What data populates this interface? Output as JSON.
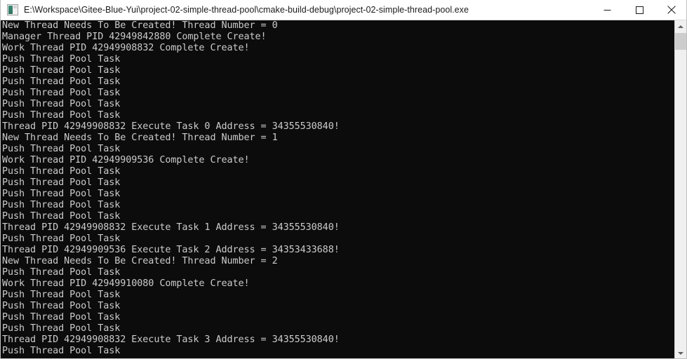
{
  "window": {
    "title": "E:\\Workspace\\Gitee-Blue-Yui\\project-02-simple-thread-pool\\cmake-build-debug\\project-02-simple-thread-pool.exe",
    "icon": "console-app-icon",
    "background_color": "#0c0c0c",
    "text_color": "#cccccc",
    "titlebar_color": "#ffffff"
  },
  "caption": {
    "minimize_label": "Minimize",
    "maximize_label": "Maximize",
    "close_label": "Close"
  },
  "scrollbar": {
    "up_arrow_label": "Scroll up",
    "down_arrow_label": "Scroll down",
    "thumb_label": "Scroll thumb"
  },
  "console": {
    "lines": [
      "New Thread Needs To Be Created! Thread Number = 0",
      "Manager Thread PID 42949842880 Complete Create!",
      "Work Thread PID 42949908832 Complete Create!",
      "Push Thread Pool Task",
      "Push Thread Pool Task",
      "Push Thread Pool Task",
      "Push Thread Pool Task",
      "Push Thread Pool Task",
      "Push Thread Pool Task",
      "Thread PID 42949908832 Execute Task 0 Address = 34355530840!",
      "New Thread Needs To Be Created! Thread Number = 1",
      "Push Thread Pool Task",
      "Work Thread PID 42949909536 Complete Create!",
      "Push Thread Pool Task",
      "Push Thread Pool Task",
      "Push Thread Pool Task",
      "Push Thread Pool Task",
      "Push Thread Pool Task",
      "Thread PID 42949908832 Execute Task 1 Address = 34355530840!",
      "Push Thread Pool Task",
      "Thread PID 42949909536 Execute Task 2 Address = 34353433688!",
      "New Thread Needs To Be Created! Thread Number = 2",
      "Push Thread Pool Task",
      "Work Thread PID 42949910080 Complete Create!",
      "Push Thread Pool Task",
      "Push Thread Pool Task",
      "Push Thread Pool Task",
      "Push Thread Pool Task",
      "Thread PID 42949908832 Execute Task 3 Address = 34355530840!",
      "Push Thread Pool Task"
    ]
  }
}
